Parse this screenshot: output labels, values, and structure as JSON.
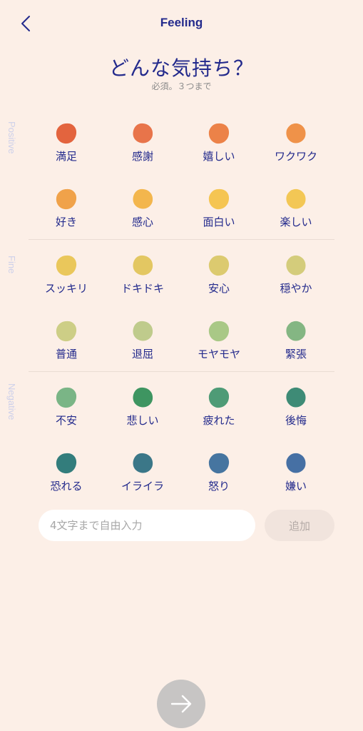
{
  "header": {
    "title": "Feeling",
    "back_icon": "chevron-left-icon"
  },
  "question": {
    "title": "どんな気持ち？",
    "subtitle": "必須。３つまで"
  },
  "categories": [
    {
      "label": "Positive"
    },
    {
      "label": "Fine"
    },
    {
      "label": "Negative"
    }
  ],
  "emotions": [
    {
      "label": "満足",
      "color": "#e3643e"
    },
    {
      "label": "感謝",
      "color": "#e8744a"
    },
    {
      "label": "嬉しい",
      "color": "#ec8248"
    },
    {
      "label": "ワクワク",
      "color": "#ef9249"
    },
    {
      "label": "好き",
      "color": "#f0a24a"
    },
    {
      "label": "感心",
      "color": "#f3b64d"
    },
    {
      "label": "面白い",
      "color": "#f5c552"
    },
    {
      "label": "楽しい",
      "color": "#f3c755"
    },
    {
      "label": "スッキリ",
      "color": "#eac75b"
    },
    {
      "label": "ドキドキ",
      "color": "#e3c762"
    },
    {
      "label": "安心",
      "color": "#dcca6f"
    },
    {
      "label": "穏やか",
      "color": "#d4cc7b"
    },
    {
      "label": "普通",
      "color": "#cdce86"
    },
    {
      "label": "退屈",
      "color": "#bfcb8c"
    },
    {
      "label": "モヤモヤ",
      "color": "#a9c886"
    },
    {
      "label": "緊張",
      "color": "#84b683"
    },
    {
      "label": "不安",
      "color": "#7ab586"
    },
    {
      "label": "悲しい",
      "color": "#3e9561"
    },
    {
      "label": "疲れた",
      "color": "#4e9b76"
    },
    {
      "label": "後悔",
      "color": "#3e8b76"
    },
    {
      "label": "恐れる",
      "color": "#337d7c"
    },
    {
      "label": "イライラ",
      "color": "#3b7788"
    },
    {
      "label": "怒り",
      "color": "#4675a0"
    },
    {
      "label": "嫌い",
      "color": "#4670a4"
    }
  ],
  "free_input": {
    "placeholder": "4文字まで自由入力",
    "value": ""
  },
  "add_button": {
    "label": "追加"
  },
  "next_button": {
    "icon": "arrow-right-icon"
  }
}
